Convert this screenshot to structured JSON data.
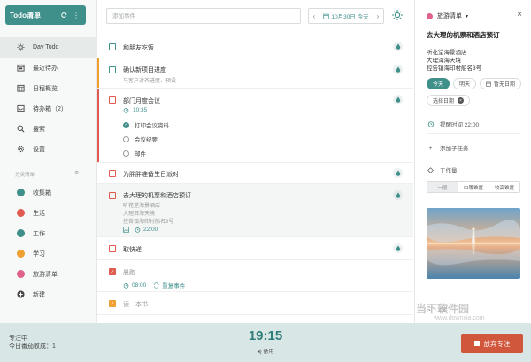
{
  "app": {
    "title": "Todo清单"
  },
  "sidebar": {
    "items": [
      {
        "label": "Day Todo",
        "icon": "sun-icon"
      },
      {
        "label": "最近待办",
        "icon": "calendar-icon"
      },
      {
        "label": "日程概览",
        "icon": "calendar-grid-icon"
      },
      {
        "label": "待办箱（2）",
        "icon": "inbox-icon"
      },
      {
        "label": "搜索",
        "icon": "search-icon"
      },
      {
        "label": "设置",
        "icon": "gear-icon"
      }
    ],
    "group_label": "分类清单",
    "lists": [
      {
        "label": "收集箱",
        "color": "#3f8f8a"
      },
      {
        "label": "生活",
        "color": "#e05a4f"
      },
      {
        "label": "工作",
        "color": "#3f8f8a"
      },
      {
        "label": "学习",
        "color": "#f0a030"
      },
      {
        "label": "旅游清单",
        "color": "#e0618a"
      }
    ],
    "new_label": "新建"
  },
  "topbar": {
    "add_placeholder": "添加事件",
    "date": "10月30日 今天"
  },
  "tasks": [
    {
      "title": "和朋友吃饭",
      "color": "#3f8f8a"
    },
    {
      "title": "确认新项目进度",
      "sub": "与客户对齐进度、预设",
      "color": "#f0a030"
    },
    {
      "title": "部门月度会议",
      "time": "10:35",
      "color": "#e05a4f",
      "subtasks": [
        {
          "label": "打印会议资料",
          "done": true
        },
        {
          "label": "会议纪要",
          "done": false
        },
        {
          "label": "邮件",
          "done": false
        }
      ]
    },
    {
      "title": "为胖胖准备生日派对",
      "color": "#e05a4f"
    },
    {
      "title": "去大理的机票和酒店预订",
      "notes": [
        "听花堂海景酒店",
        "大理洱海天境",
        "控告镇海印村船名3号"
      ],
      "time": "22:00",
      "color": "#e0618a"
    },
    {
      "title": "取快递",
      "color": "#e05a4f"
    },
    {
      "title": "晨跑",
      "time": "08:00",
      "repeat": "重复事件",
      "color": "#e05a4f",
      "done": true
    },
    {
      "title": "读一本书",
      "color": "#f0a030",
      "done": true
    }
  ],
  "detail": {
    "list_name": "旅游清单",
    "list_color": "#e0618a",
    "title": "去大理的机票和酒店预订",
    "notes": [
      "听花堂海景酒店",
      "大理洱海天境",
      "控告镇海印村船名3号"
    ],
    "chips": [
      "今天",
      "明天",
      "暂无日期"
    ],
    "chip_select": "选择日期",
    "reminder": "提醒时间 22:00",
    "add_subtask": "添加子任务",
    "effort_label": "工作量",
    "effort_options": [
      "一般",
      "中等难度",
      "较高难度"
    ]
  },
  "footer": {
    "status": "专注中",
    "today_count": "今日番茄收成：1",
    "timer": "19:15",
    "mode": "备用",
    "abandon": "放弃专注"
  },
  "watermark": {
    "text": "当下软件园",
    "url": "www.downxia.com"
  },
  "colors": {
    "accent": "#3f8f8a",
    "danger": "#d0573c",
    "footer_bg": "#d9e6e6"
  }
}
